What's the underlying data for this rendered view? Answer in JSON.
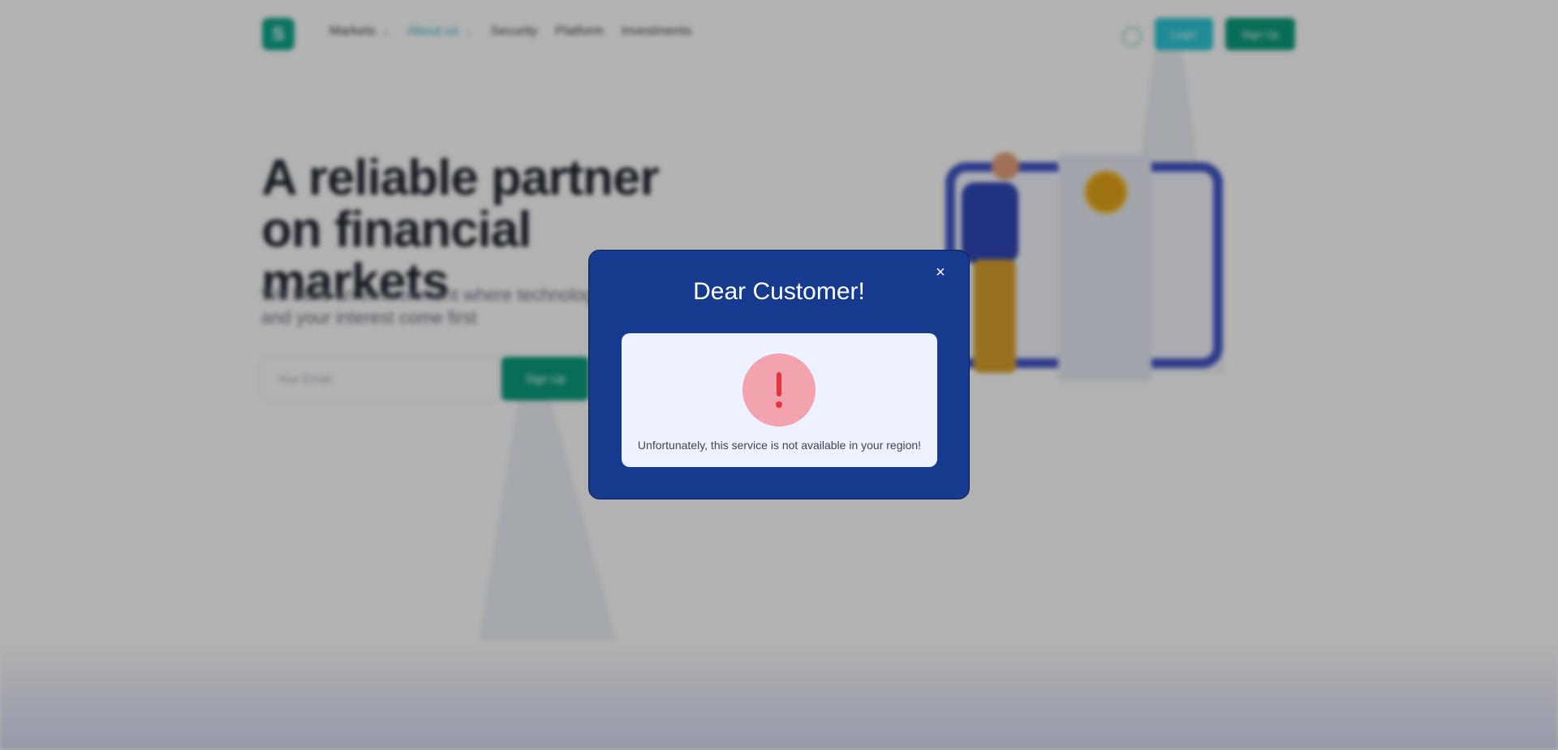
{
  "header": {
    "logo_letter": "S",
    "nav": [
      {
        "label": "Markets",
        "has_dropdown": true,
        "active": false
      },
      {
        "label": "About us",
        "has_dropdown": true,
        "active": true
      },
      {
        "label": "Security",
        "has_dropdown": false,
        "active": false
      },
      {
        "label": "Platform",
        "has_dropdown": false,
        "active": false
      },
      {
        "label": "Investments",
        "has_dropdown": false,
        "active": false
      }
    ],
    "login_label": "Login",
    "signup_label": "Sign Up"
  },
  "hero": {
    "title": "A reliable partner on financial markets",
    "subtitle": "We build an environment where technology and your interest come first",
    "email_placeholder": "Your Email",
    "signup_label": "Sign Up"
  },
  "modal": {
    "title": "Dear Customer!",
    "close_icon": "close-icon",
    "alert_icon": "exclamation-icon",
    "message": "Unfortunately, this service is not available in your region!"
  },
  "colors": {
    "modal_bg": "#163b8e",
    "panel_bg": "#eef1ff",
    "alert_circle": "#f2a3ad",
    "alert_mark": "#e8323e",
    "brand_green": "#0c9d7c",
    "brand_cyan": "#2ec8d6"
  }
}
